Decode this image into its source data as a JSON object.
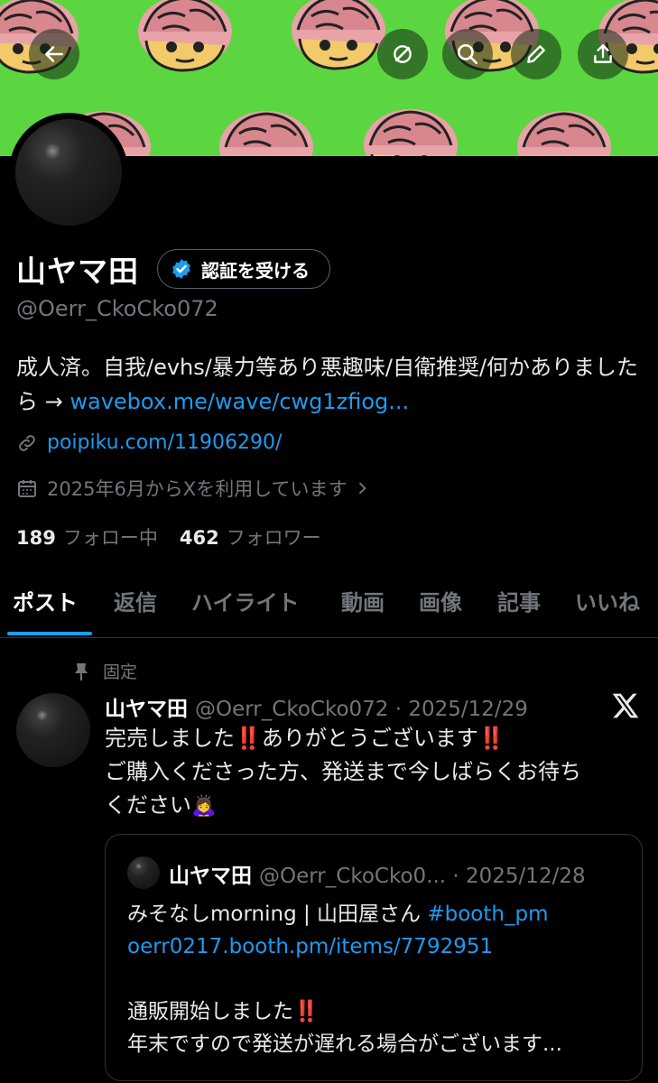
{
  "topbar": {
    "back_icon": "arrow-left-icon",
    "grok_icon": "circle-slash-icon",
    "search_icon": "search-icon",
    "edit_icon": "pencil-icon",
    "share_icon": "share-icon"
  },
  "profile": {
    "display_name": "山ヤマ田",
    "verify_label": "認証を受ける",
    "handle": "@Oerr_CkoCko072",
    "bio_text": "成人済。自我/evhs/暴力等あり悪趣味/自衛推奨/何かありましたら → ",
    "bio_link": "wavebox.me/wave/cwg1zfiog...",
    "website": "poipiku.com/11906290/",
    "joined": "2025年6月からXを利用しています",
    "following_count": "189",
    "following_label": "フォロー中",
    "followers_count": "462",
    "followers_label": "フォロワー"
  },
  "tabs": [
    "ポスト",
    "返信",
    "ハイライト",
    "動画",
    "画像",
    "記事",
    "いいね"
  ],
  "post": {
    "pinned_label": "固定",
    "author": "山ヤマ田",
    "handle_date": "@Oerr_CkoCko072 · 2025/12/29",
    "line1_a": "完売しました",
    "line1_b": "ありがとうございます",
    "bang": "‼️",
    "line2": "ご購入くださった方、発送まで今しばらくお待ち",
    "line3": "ください",
    "emoji": "🙇‍♀️"
  },
  "quote": {
    "author": "山ヤマ田",
    "handle_date": "@Oerr_CkoCko0... · 2025/12/28",
    "line1_text": "みそなしmorning | 山田屋さん ",
    "line1_tag": "#booth_pm",
    "line2_link": "oerr0217.booth.pm/items/7792951",
    "line3": "通販開始しました",
    "line4": "年末ですので発送が遅れる場合がございます..."
  },
  "colors": {
    "accent": "#1d9bf0",
    "banner": "#5cd640",
    "background": "#000000"
  }
}
